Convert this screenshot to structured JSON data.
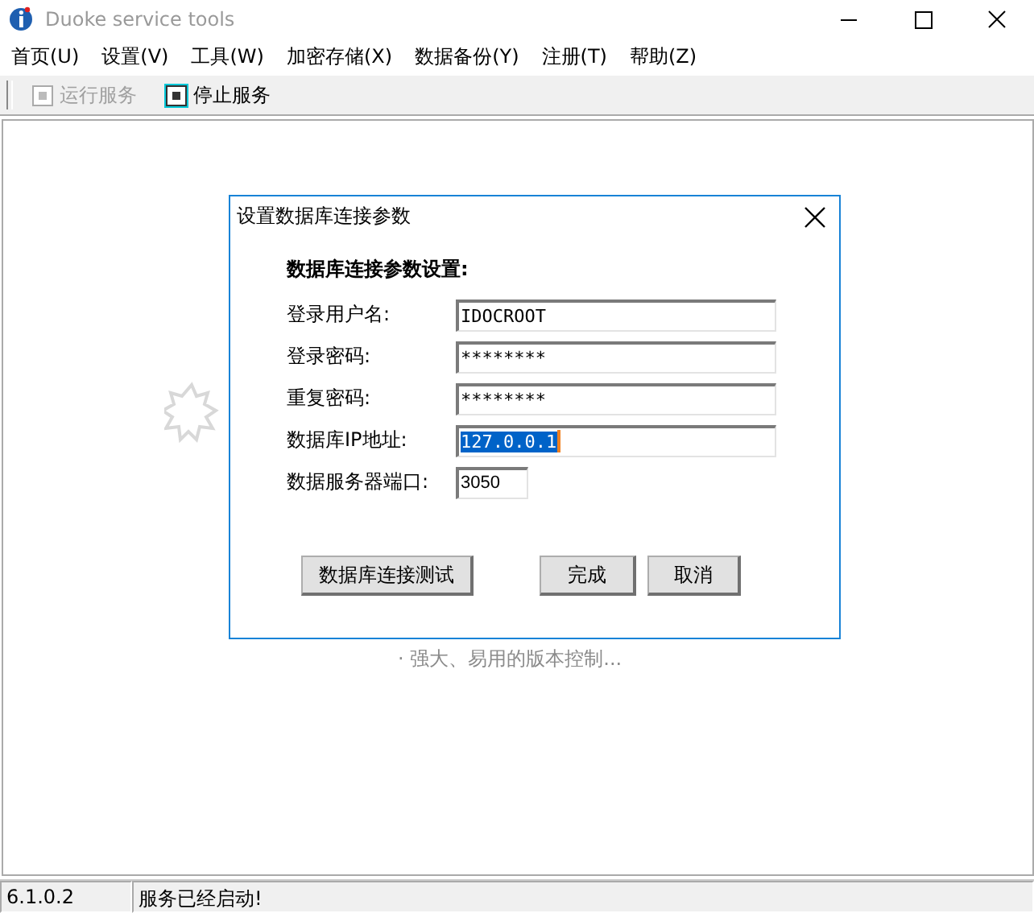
{
  "window": {
    "title": "Duoke service tools"
  },
  "menu": [
    {
      "label": "首页(U)"
    },
    {
      "label": "设置(V)"
    },
    {
      "label": "工具(W)"
    },
    {
      "label": "加密存储(X)"
    },
    {
      "label": "数据备份(Y)"
    },
    {
      "label": "注册(T)"
    },
    {
      "label": "帮助(Z)"
    }
  ],
  "toolbar": [
    {
      "label": "运行服务",
      "disabled": true,
      "focused": false
    },
    {
      "label": "停止服务",
      "disabled": false,
      "focused": true
    }
  ],
  "background_text": "· 强大、易用的版本控制...",
  "dialog": {
    "title": "设置数据库连接参数",
    "heading": "数据库连接参数设置:",
    "fields": [
      {
        "label": "登录用户名:",
        "value": "IDOCROOT",
        "text_selected": false,
        "kind": "text"
      },
      {
        "label": "登录密码:",
        "value": "********",
        "text_selected": false,
        "kind": "text"
      },
      {
        "label": "重复密码:",
        "value": "********",
        "text_selected": false,
        "kind": "text"
      },
      {
        "label": "数据库IP地址:",
        "value": "127.0.0.1",
        "text_selected": true,
        "kind": "text"
      },
      {
        "label": "数据服务器端口:",
        "value": "3050",
        "text_selected": false,
        "kind": "number"
      }
    ],
    "buttons": [
      {
        "label": "数据库连接测试",
        "kind": "test"
      },
      {
        "label": "完成",
        "kind": "ok"
      },
      {
        "label": "取消",
        "kind": "cancel"
      }
    ]
  },
  "status_bar": [
    {
      "text": "6.1.0.2"
    },
    {
      "text": "服务已经启动!"
    }
  ]
}
